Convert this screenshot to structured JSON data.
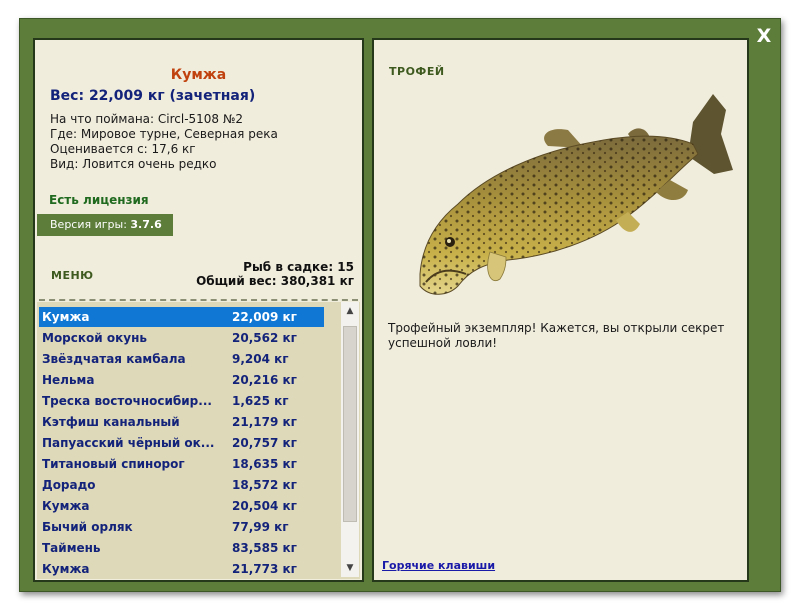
{
  "close_label": "X",
  "fish_card": {
    "name": "Кумжа",
    "weight_line": "Вес: 22,009 кг (зачетная)",
    "caught_on": "На что поймана: Circl-5108 №2",
    "location": "Где: Мировое турне, Северная река",
    "value": "Оценивается с: 17,6 кг",
    "rarity": "Вид: Ловится очень редко"
  },
  "license_label": "Есть лицензия",
  "version": {
    "label": "Версия игры: ",
    "value": "3.7.6"
  },
  "menu_label": "МЕНЮ",
  "keepnet": {
    "count_line": "Рыб в садке: 15",
    "weight_line": "Общий вес: 380,381 кг"
  },
  "fish_list": [
    {
      "name": "Кумжа",
      "weight": "22,009 кг"
    },
    {
      "name": "Морской окунь",
      "weight": "20,562 кг"
    },
    {
      "name": "Звёздчатая камбала",
      "weight": "9,204 кг"
    },
    {
      "name": "Нельма",
      "weight": "20,216 кг"
    },
    {
      "name": "Треска восточносибир...",
      "weight": "1,625 кг"
    },
    {
      "name": "Кэтфиш канальный",
      "weight": "21,179 кг"
    },
    {
      "name": "Папуасский чёрный ок...",
      "weight": "20,757 кг"
    },
    {
      "name": "Титановый спинорог",
      "weight": "18,635 кг"
    },
    {
      "name": "Дорадо",
      "weight": "18,572 кг"
    },
    {
      "name": "Кумжа",
      "weight": "20,504 кг"
    },
    {
      "name": "Бычий орляк",
      "weight": "77,99 кг"
    },
    {
      "name": "Таймень",
      "weight": "83,585 кг"
    },
    {
      "name": "Кумжа",
      "weight": "21,773 кг"
    }
  ],
  "trophy_label": "ТРОФЕЙ",
  "description": "Трофейный экземпляр! Кажется, вы открыли секрет успешной ловли!",
  "hotkeys_label": "Горячие клавиши",
  "colors": {
    "frame": "#5d7d3b",
    "panel": "#f1eddd",
    "list_bg": "#ddd9b9",
    "selected_row": "#1177d4",
    "fish_name": "#c0420f",
    "list_text": "#14237a"
  }
}
